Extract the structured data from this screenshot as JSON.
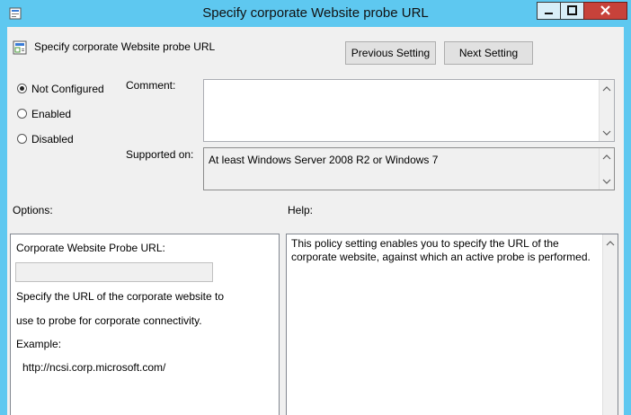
{
  "window": {
    "title": "Specify corporate Website probe URL"
  },
  "header": {
    "policy_name": "Specify corporate Website probe URL",
    "previous_label": "Previous Setting",
    "next_label": "Next Setting"
  },
  "state": {
    "options": [
      {
        "label": "Not Configured",
        "selected": true
      },
      {
        "label": "Enabled",
        "selected": false
      },
      {
        "label": "Disabled",
        "selected": false
      }
    ]
  },
  "comment": {
    "label": "Comment:",
    "value": ""
  },
  "supported": {
    "label": "Supported on:",
    "value": "At least Windows Server 2008 R2 or Windows 7"
  },
  "options_panel": {
    "heading": "Options:",
    "field_label": "Corporate Website Probe URL:",
    "field_value": "",
    "desc_line1": "Specify the URL of the corporate website to",
    "desc_line2": "use to probe for corporate connectivity.",
    "example_label": "Example:",
    "example_value": "http://ncsi.corp.microsoft.com/"
  },
  "help_panel": {
    "heading": "Help:",
    "line1": "This policy setting enables you to specify the URL of the",
    "line2": "corporate website, against which an active probe is performed."
  },
  "icons": [
    "policy-icon",
    "minimize-icon",
    "maximize-icon",
    "close-icon",
    "scroll-up-icon",
    "scroll-down-icon"
  ],
  "colors": {
    "title_bar": "#5ec8f0",
    "close_button": "#c7423a",
    "dialog_bg": "#f0f0f0"
  }
}
